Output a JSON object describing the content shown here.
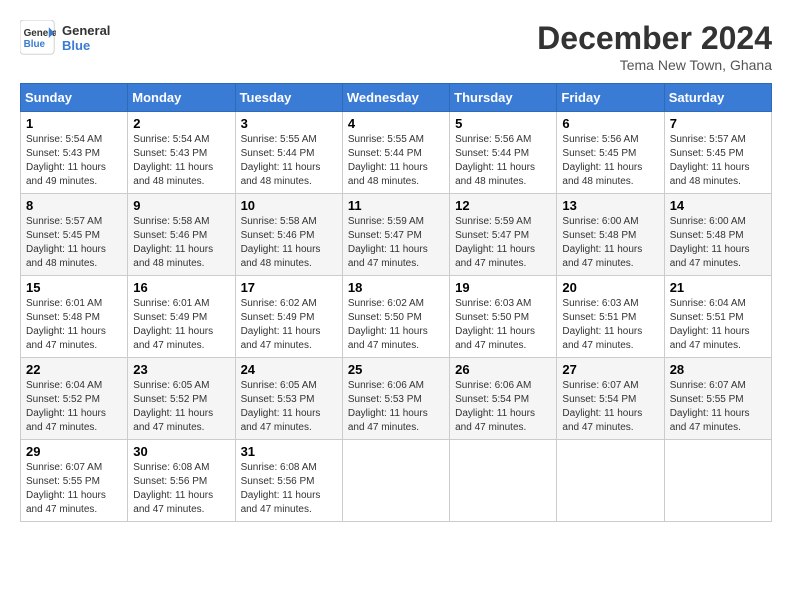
{
  "header": {
    "logo_line1": "General",
    "logo_line2": "Blue",
    "month_title": "December 2024",
    "subtitle": "Tema New Town, Ghana"
  },
  "weekdays": [
    "Sunday",
    "Monday",
    "Tuesday",
    "Wednesday",
    "Thursday",
    "Friday",
    "Saturday"
  ],
  "weeks": [
    [
      {
        "day": 1,
        "sunrise": "5:54 AM",
        "sunset": "5:43 PM",
        "daylight": "11 hours and 49 minutes."
      },
      {
        "day": 2,
        "sunrise": "5:54 AM",
        "sunset": "5:43 PM",
        "daylight": "11 hours and 48 minutes."
      },
      {
        "day": 3,
        "sunrise": "5:55 AM",
        "sunset": "5:44 PM",
        "daylight": "11 hours and 48 minutes."
      },
      {
        "day": 4,
        "sunrise": "5:55 AM",
        "sunset": "5:44 PM",
        "daylight": "11 hours and 48 minutes."
      },
      {
        "day": 5,
        "sunrise": "5:56 AM",
        "sunset": "5:44 PM",
        "daylight": "11 hours and 48 minutes."
      },
      {
        "day": 6,
        "sunrise": "5:56 AM",
        "sunset": "5:45 PM",
        "daylight": "11 hours and 48 minutes."
      },
      {
        "day": 7,
        "sunrise": "5:57 AM",
        "sunset": "5:45 PM",
        "daylight": "11 hours and 48 minutes."
      }
    ],
    [
      {
        "day": 8,
        "sunrise": "5:57 AM",
        "sunset": "5:45 PM",
        "daylight": "11 hours and 48 minutes."
      },
      {
        "day": 9,
        "sunrise": "5:58 AM",
        "sunset": "5:46 PM",
        "daylight": "11 hours and 48 minutes."
      },
      {
        "day": 10,
        "sunrise": "5:58 AM",
        "sunset": "5:46 PM",
        "daylight": "11 hours and 48 minutes."
      },
      {
        "day": 11,
        "sunrise": "5:59 AM",
        "sunset": "5:47 PM",
        "daylight": "11 hours and 47 minutes."
      },
      {
        "day": 12,
        "sunrise": "5:59 AM",
        "sunset": "5:47 PM",
        "daylight": "11 hours and 47 minutes."
      },
      {
        "day": 13,
        "sunrise": "6:00 AM",
        "sunset": "5:48 PM",
        "daylight": "11 hours and 47 minutes."
      },
      {
        "day": 14,
        "sunrise": "6:00 AM",
        "sunset": "5:48 PM",
        "daylight": "11 hours and 47 minutes."
      }
    ],
    [
      {
        "day": 15,
        "sunrise": "6:01 AM",
        "sunset": "5:48 PM",
        "daylight": "11 hours and 47 minutes."
      },
      {
        "day": 16,
        "sunrise": "6:01 AM",
        "sunset": "5:49 PM",
        "daylight": "11 hours and 47 minutes."
      },
      {
        "day": 17,
        "sunrise": "6:02 AM",
        "sunset": "5:49 PM",
        "daylight": "11 hours and 47 minutes."
      },
      {
        "day": 18,
        "sunrise": "6:02 AM",
        "sunset": "5:50 PM",
        "daylight": "11 hours and 47 minutes."
      },
      {
        "day": 19,
        "sunrise": "6:03 AM",
        "sunset": "5:50 PM",
        "daylight": "11 hours and 47 minutes."
      },
      {
        "day": 20,
        "sunrise": "6:03 AM",
        "sunset": "5:51 PM",
        "daylight": "11 hours and 47 minutes."
      },
      {
        "day": 21,
        "sunrise": "6:04 AM",
        "sunset": "5:51 PM",
        "daylight": "11 hours and 47 minutes."
      }
    ],
    [
      {
        "day": 22,
        "sunrise": "6:04 AM",
        "sunset": "5:52 PM",
        "daylight": "11 hours and 47 minutes."
      },
      {
        "day": 23,
        "sunrise": "6:05 AM",
        "sunset": "5:52 PM",
        "daylight": "11 hours and 47 minutes."
      },
      {
        "day": 24,
        "sunrise": "6:05 AM",
        "sunset": "5:53 PM",
        "daylight": "11 hours and 47 minutes."
      },
      {
        "day": 25,
        "sunrise": "6:06 AM",
        "sunset": "5:53 PM",
        "daylight": "11 hours and 47 minutes."
      },
      {
        "day": 26,
        "sunrise": "6:06 AM",
        "sunset": "5:54 PM",
        "daylight": "11 hours and 47 minutes."
      },
      {
        "day": 27,
        "sunrise": "6:07 AM",
        "sunset": "5:54 PM",
        "daylight": "11 hours and 47 minutes."
      },
      {
        "day": 28,
        "sunrise": "6:07 AM",
        "sunset": "5:55 PM",
        "daylight": "11 hours and 47 minutes."
      }
    ],
    [
      {
        "day": 29,
        "sunrise": "6:07 AM",
        "sunset": "5:55 PM",
        "daylight": "11 hours and 47 minutes."
      },
      {
        "day": 30,
        "sunrise": "6:08 AM",
        "sunset": "5:56 PM",
        "daylight": "11 hours and 47 minutes."
      },
      {
        "day": 31,
        "sunrise": "6:08 AM",
        "sunset": "5:56 PM",
        "daylight": "11 hours and 47 minutes."
      },
      null,
      null,
      null,
      null
    ]
  ]
}
